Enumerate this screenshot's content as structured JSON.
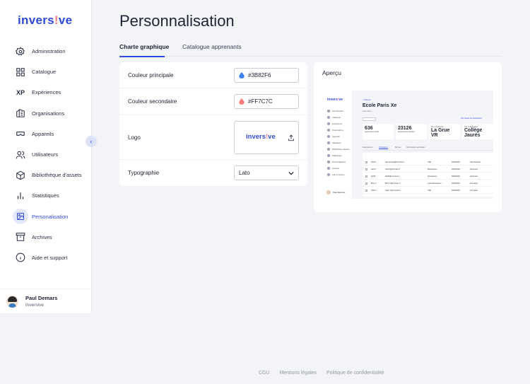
{
  "brand": {
    "logo_main": "invers",
    "logo_dot": "!",
    "logo_end": "ve",
    "accent": "#2F4BD8",
    "secondary": "#FF7C7C"
  },
  "sidebar": {
    "items": [
      {
        "label": "Administration",
        "icon": "gear-icon"
      },
      {
        "label": "Catalogue",
        "icon": "grid-icon"
      },
      {
        "label": "Expériences",
        "icon": "xp-icon",
        "glyph": "XP"
      },
      {
        "label": "Organisations",
        "icon": "building-icon"
      },
      {
        "label": "Appareils",
        "icon": "vr-headset-icon"
      },
      {
        "label": "Utilisateurs",
        "icon": "users-icon"
      },
      {
        "label": "Bibliothèque d'assets",
        "icon": "cube-icon"
      },
      {
        "label": "Statistiques",
        "icon": "bar-chart-icon"
      },
      {
        "label": "Personalisation",
        "icon": "image-icon",
        "active": true
      },
      {
        "label": "Archives",
        "icon": "archive-icon"
      },
      {
        "label": "Aide et support",
        "icon": "info-icon"
      }
    ],
    "collapse_glyph": "‹",
    "user": {
      "name": "Paul Demars",
      "org": "Inversive"
    }
  },
  "main": {
    "title": "Personnalisation",
    "tabs": [
      {
        "label": "Charte graphique",
        "active": true
      },
      {
        "label": "Catalogue apprenants",
        "active": false
      }
    ],
    "settings": {
      "primary_label": "Couleur principale",
      "primary_value": "#3B82F6",
      "primary_color": "#3B82F6",
      "secondary_label": "Couleur secondaire",
      "secondary_value": "#FF7C7C",
      "secondary_color": "#FF7C7C",
      "logo_label": "Logo",
      "typography_label": "Typographie",
      "typography_value": "Lato"
    },
    "preview": {
      "title": "Aperçu",
      "mini": {
        "back": "< Retour",
        "title": "Ecole Paris Xe",
        "subtitle": "Education",
        "link": "Voir toutes les statistiques",
        "nav": [
          "Administration",
          "Catalogue",
          "Expériences",
          "Organisations",
          "Appareils",
          "Utilisateurs",
          "Bibliothèque d'assets",
          "Statistiques",
          "Personnalisation",
          "Archives",
          "Aide et support"
        ],
        "stats": [
          {
            "value": "636",
            "label": "Apprenants actifs"
          },
          {
            "value": "23126",
            "label": "Expériences lancées"
          },
          {
            "value": "La Grue VR",
            "label": "Top expérience"
          },
          {
            "value": "Collège Jaurès",
            "label": "Top organisation"
          }
        ],
        "tabs": [
          "Expériences",
          "Utilisateurs",
          "Bornes",
          "Informations générales"
        ],
        "rows": [
          [
            "Paul D.",
            "paul.demars@inversive.fr",
            "CSE",
            "09/03/2024",
            "Administrateur"
          ],
          [
            "Jack K.",
            "Jack.K@inversive.fr",
            "Développeur",
            "09/03/2024",
            "Apprenant"
          ],
          [
            "Alal B.",
            "Alal.B@inversive.fr",
            "Développeur",
            "09/03/2024",
            "Apprenant"
          ],
          [
            "Brice V.",
            "Brice.V@inversive.fr",
            "Lead Développeur",
            "09/03/2024",
            "Formateur"
          ],
          [
            "Noah Y.",
            "Noah.Y@inversive.fr",
            "CSE",
            "09/03/2024",
            "Formateur"
          ]
        ],
        "user": "Paul Demars"
      }
    }
  },
  "footer": {
    "links": [
      "CGU",
      "Mentions légales",
      "Politique de confidentialité"
    ]
  }
}
